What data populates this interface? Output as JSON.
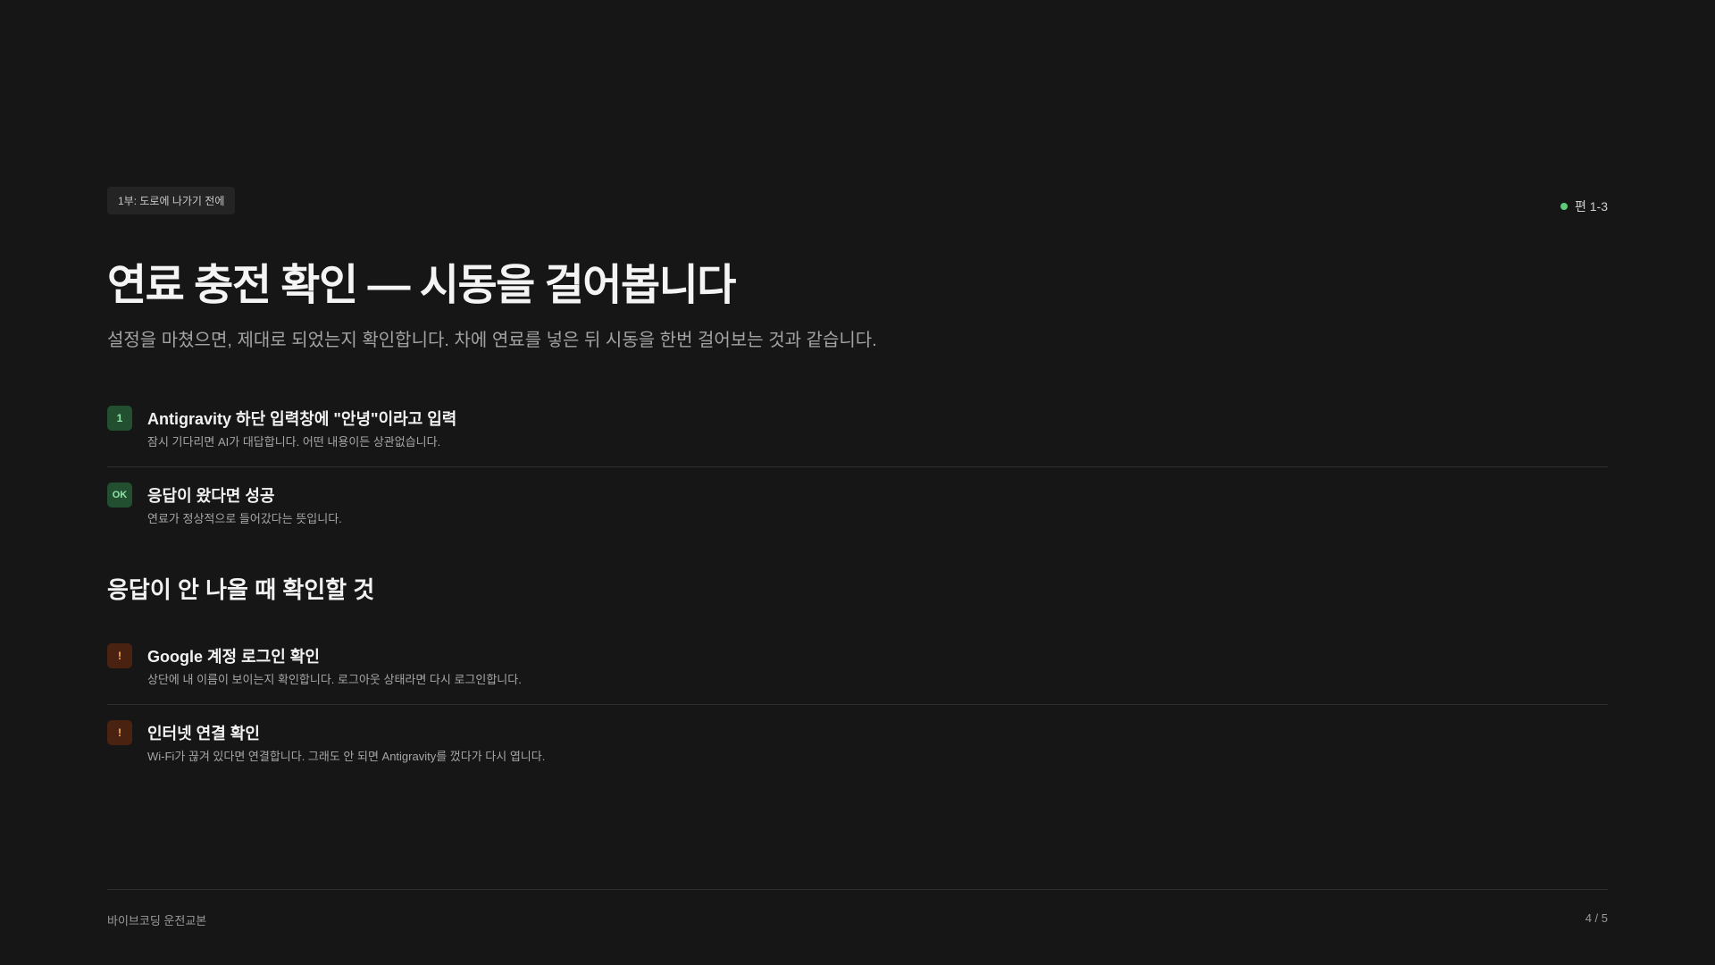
{
  "header": {
    "part_badge": "1부: 도로에 나가기 전에",
    "episode": "편 1-3"
  },
  "title": "연료 충전 확인 — 시동을 걸어봅니다",
  "subtitle": "설정을 마쳤으면, 제대로 되었는지 확인합니다. 차에 연료를 넣은 뒤 시동을 한번 걸어보는 것과 같습니다.",
  "steps": [
    {
      "icon": "1",
      "title": "Antigravity 하단 입력창에 \"안녕\"이라고 입력",
      "desc": "잠시 기다리면 AI가 대답합니다. 어떤 내용이든 상관없습니다."
    },
    {
      "icon": "OK",
      "title": "응답이 왔다면 성공",
      "desc": "연료가 정상적으로 들어갔다는 뜻입니다."
    }
  ],
  "troubleshoot": {
    "heading": "응답이 안 나올 때 확인할 것",
    "items": [
      {
        "icon": "!",
        "title": "Google 계정 로그인 확인",
        "desc": "상단에 내 이름이 보이는지 확인합니다. 로그아웃 상태라면 다시 로그인합니다."
      },
      {
        "icon": "!",
        "title": "인터넷 연결 확인",
        "desc": "Wi-Fi가 끊겨 있다면 연결합니다. 그래도 안 되면 Antigravity를 껐다가 다시 엽니다."
      }
    ]
  },
  "footer": {
    "brand": "바이브코딩 운전교본",
    "page": "4 / 5"
  },
  "colors": {
    "background": "#161616",
    "success": "#5ccb7a",
    "warning": "#ffb158"
  }
}
